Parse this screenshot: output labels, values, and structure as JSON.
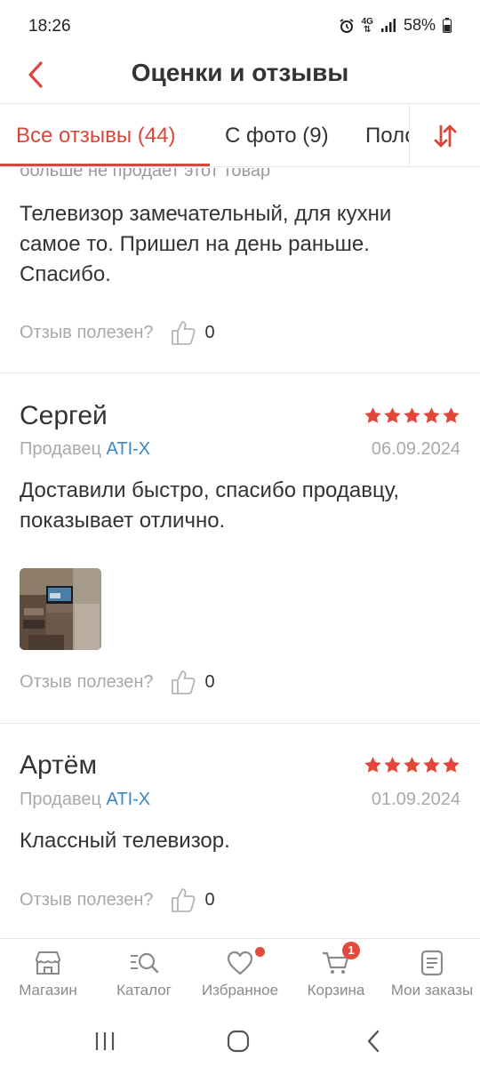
{
  "status_bar": {
    "time": "18:26",
    "network": "4G",
    "battery": "58%",
    "icons": [
      "alarm-icon",
      "network-4g-icon",
      "signal-icon",
      "battery-icon"
    ]
  },
  "header": {
    "title": "Оценки и отзывы",
    "back_icon": "chevron-left-icon"
  },
  "tabs": {
    "items": [
      {
        "label": "Все отзывы (44)",
        "active": true
      },
      {
        "label": "С фото (9)",
        "active": false
      },
      {
        "label": "Поло",
        "active": false
      }
    ],
    "sort_icon": "sort-arrows-icon"
  },
  "colors": {
    "accent": "#d9473a",
    "star": "#e4473a",
    "link": "#3c87c4",
    "muted": "#a9a9a9",
    "text": "#333333"
  },
  "reviews": [
    {
      "cut_text": "больше не продает этот товар",
      "text": "Телевизор замечательный, для кухни самое то. Пришел на день раньше. Спасибо.",
      "helpful_label": "Отзыв полезен?",
      "helpful_count": "0"
    },
    {
      "author": "Сергей",
      "rating": 5,
      "seller_prefix": "Продавец",
      "seller": "ATI-X",
      "date": "06.09.2024",
      "text": "Доставили быстро, спасибо продавцу, показывает отлично.",
      "has_photo": true,
      "helpful_label": "Отзыв полезен?",
      "helpful_count": "0"
    },
    {
      "author": "Артём",
      "rating": 5,
      "seller_prefix": "Продавец",
      "seller": "ATI-X",
      "date": "01.09.2024",
      "text": "Классный телевизор.",
      "helpful_label": "Отзыв полезен?",
      "helpful_count": "0"
    }
  ],
  "bottom_nav": {
    "items": [
      {
        "label": "Магазин",
        "icon": "store-icon"
      },
      {
        "label": "Каталог",
        "icon": "catalog-search-icon"
      },
      {
        "label": "Избранное",
        "icon": "heart-icon",
        "dot": true
      },
      {
        "label": "Корзина",
        "icon": "cart-icon",
        "badge": "1"
      },
      {
        "label": "Мои заказы",
        "icon": "orders-icon"
      }
    ]
  }
}
